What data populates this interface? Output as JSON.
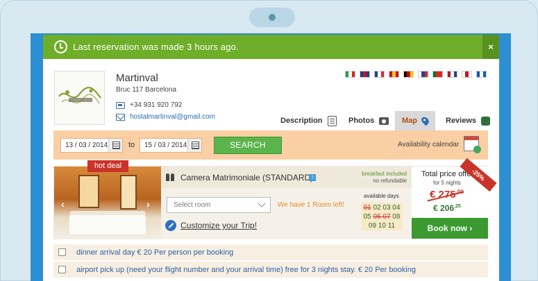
{
  "notice": {
    "text": "Last reservation was made 3 hours ago.",
    "close": "×"
  },
  "hotel": {
    "name": "Martinval",
    "address": "Bruc 117 Barcelona",
    "phone": "+34 931 920 792",
    "email": "hostalmartinval@gmail.com"
  },
  "languages": [
    {
      "name": "italian-flag-icon",
      "colors": [
        "#1f9e45",
        "#ffffff",
        "#d52b1e"
      ]
    },
    {
      "name": "english-flag-icon",
      "colors": [
        "#1d3f8c",
        "#c8102e",
        "#1d3f8c"
      ]
    },
    {
      "name": "french-flag-icon",
      "colors": [
        "#1f3f97",
        "#ffffff",
        "#d62b2b"
      ]
    },
    {
      "name": "spanish-flag-icon",
      "colors": [
        "#c8102e",
        "#f6c400",
        "#c8102e"
      ]
    },
    {
      "name": "german-flag-icon",
      "colors": [
        "#000000",
        "#dd0000",
        "#ffce00"
      ]
    },
    {
      "name": "russian-flag-icon",
      "colors": [
        "#ffffff",
        "#1e43a5",
        "#d52b1e"
      ]
    },
    {
      "name": "portuguese-flag-icon",
      "colors": [
        "#0a6e2c",
        "#d52b1e",
        "#d52b1e"
      ]
    },
    {
      "name": "dutch-flag-icon",
      "colors": [
        "#ae1c28",
        "#ffffff",
        "#21468b"
      ]
    },
    {
      "name": "japanese-flag-icon",
      "colors": [
        "#ffffff",
        "#c8102e",
        "#ffffff"
      ]
    },
    {
      "name": "greek-flag-icon",
      "colors": [
        "#0d5eaf",
        "#ffffff",
        "#0d5eaf"
      ]
    }
  ],
  "tabs": [
    {
      "label": "Description",
      "icon": "document-icon"
    },
    {
      "label": "Photos",
      "icon": "camera-icon"
    },
    {
      "label": "Map",
      "icon": "map-pin-icon",
      "active": true
    },
    {
      "label": "Reviews",
      "icon": "reviews-icon"
    }
  ],
  "search": {
    "checkin": "13 / 03 / 2014",
    "to": "to",
    "checkout": "15 / 03 / 2014",
    "button": "SEARCH",
    "availability": "Availability calendar"
  },
  "room": {
    "badge": "hot deal",
    "title": "Camera Matrimoniale (STANDARD)",
    "info": "i",
    "breakfast": "breakfast included",
    "refund": "no refundable",
    "select_placeholder": "Select room",
    "rooms_left": "We have 1 Room left!",
    "days_label": "available days",
    "days_row1_unavailable": "01",
    "days_row1_available": "02 03 04",
    "days_row2_a": "05",
    "days_row2_unavailable": "06 07",
    "days_row2_b": "08",
    "days_row3": "09 10 11",
    "customize": "Customize your Trip!",
    "discount": "-25%",
    "price_title": "Total price offer",
    "price_nights": "for 5 nights",
    "price_old": "€ 275",
    "price_old_cents": ",00",
    "price_new": "€ 206",
    "price_new_cents": ",25",
    "book": "Book now  ›"
  },
  "extras": [
    {
      "label": "dinner arrival day € 20 Per person per booking"
    },
    {
      "label": "airport pick up (need your flight number and your arrival time) free for 3 nights stay. € 20 Per booking"
    }
  ],
  "colors": {
    "notice": "#6eae28",
    "search_bar": "#f9cfa3",
    "search_button": "#5cb44c",
    "book_button": "#3b9a2f",
    "hot_deal": "#c9332a"
  }
}
